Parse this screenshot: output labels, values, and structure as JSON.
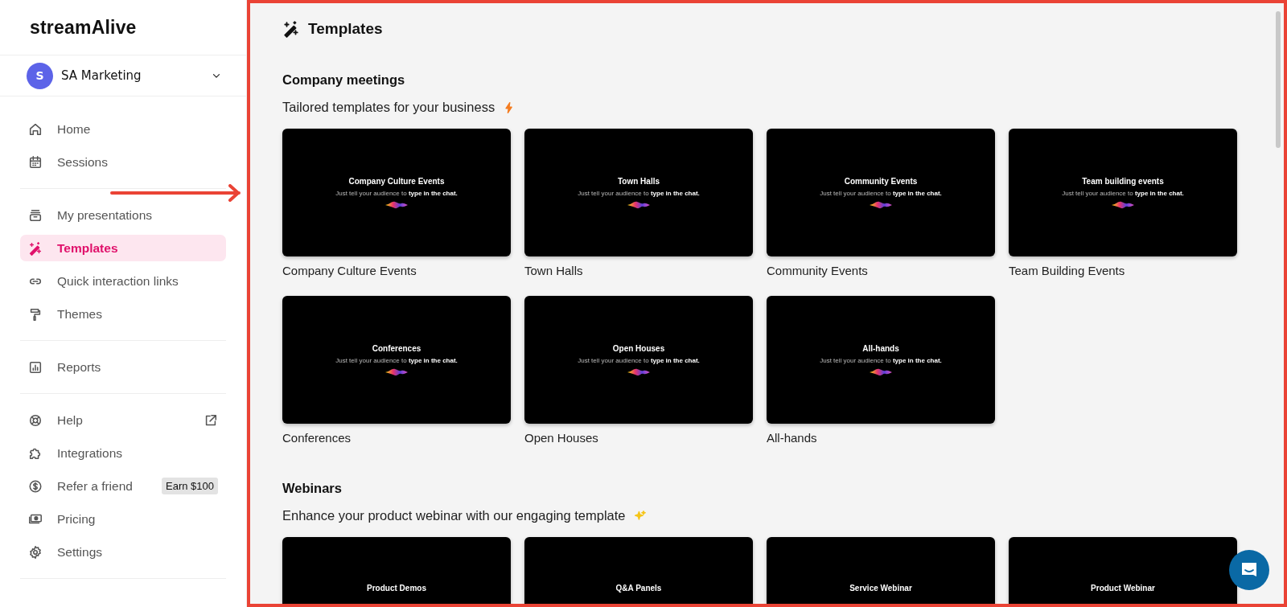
{
  "logo": {
    "text": "streamAlive"
  },
  "workspace": {
    "avatar": "S",
    "name": "SA Marketing"
  },
  "nav_groups": [
    {
      "items": [
        {
          "label": "Home",
          "selected": false
        },
        {
          "label": "Sessions",
          "selected": false
        }
      ]
    },
    {
      "items": [
        {
          "label": "My presentations",
          "selected": false
        },
        {
          "label": "Templates",
          "selected": true
        },
        {
          "label": "Quick interaction links",
          "selected": false
        },
        {
          "label": "Themes",
          "selected": false
        }
      ]
    },
    {
      "items": [
        {
          "label": "Reports",
          "selected": false
        }
      ]
    },
    {
      "items": [
        {
          "label": "Help",
          "selected": false,
          "external": true
        },
        {
          "label": "Integrations",
          "selected": false
        },
        {
          "label": "Refer a friend",
          "selected": false,
          "badge": "Earn $100"
        },
        {
          "label": "Pricing",
          "selected": false
        },
        {
          "label": "Settings",
          "selected": false
        }
      ]
    }
  ],
  "annotations": {
    "frame": true,
    "arrow": true
  },
  "page_title": "Templates",
  "sections": [
    {
      "heading": "Company meetings",
      "subtitle": "Tailored templates for your business",
      "cards": [
        {
          "slide_title": "Company Culture Events",
          "slide_text": "Just tell your audience to **type in the chat.**",
          "label": "Company Culture Events"
        },
        {
          "slide_title": "Town Halls",
          "slide_text": "Just tell your audience to **type in the chat.**",
          "label": "Town Halls"
        },
        {
          "slide_title": "Community Events",
          "slide_text": "Just tell your audience to **type in the chat.**",
          "label": "Community Events"
        },
        {
          "slide_title": "Team building events",
          "slide_text": "Just tell your audience to **type in the chat.**",
          "label": "Team Building Events"
        },
        {
          "slide_title": "Conferences",
          "slide_text": "Just tell your audience to **type in the chat.**",
          "label": "Conferences"
        },
        {
          "slide_title": "Open Houses",
          "slide_text": "Just tell your audience to **type in the chat.**",
          "label": "Open Houses"
        },
        {
          "slide_title": "All-hands",
          "slide_text": "Just tell your audience to **type in the chat.**",
          "label": "All-hands"
        }
      ]
    },
    {
      "heading": "Webinars",
      "subtitle": "Enhance your product webinar with our engaging template",
      "cards": [
        {
          "slide_title": "Product Demos"
        },
        {
          "slide_title": "Q&A Panels"
        },
        {
          "slide_title": "Service Webinar"
        },
        {
          "slide_title": "Product Webinar"
        }
      ]
    }
  ]
}
